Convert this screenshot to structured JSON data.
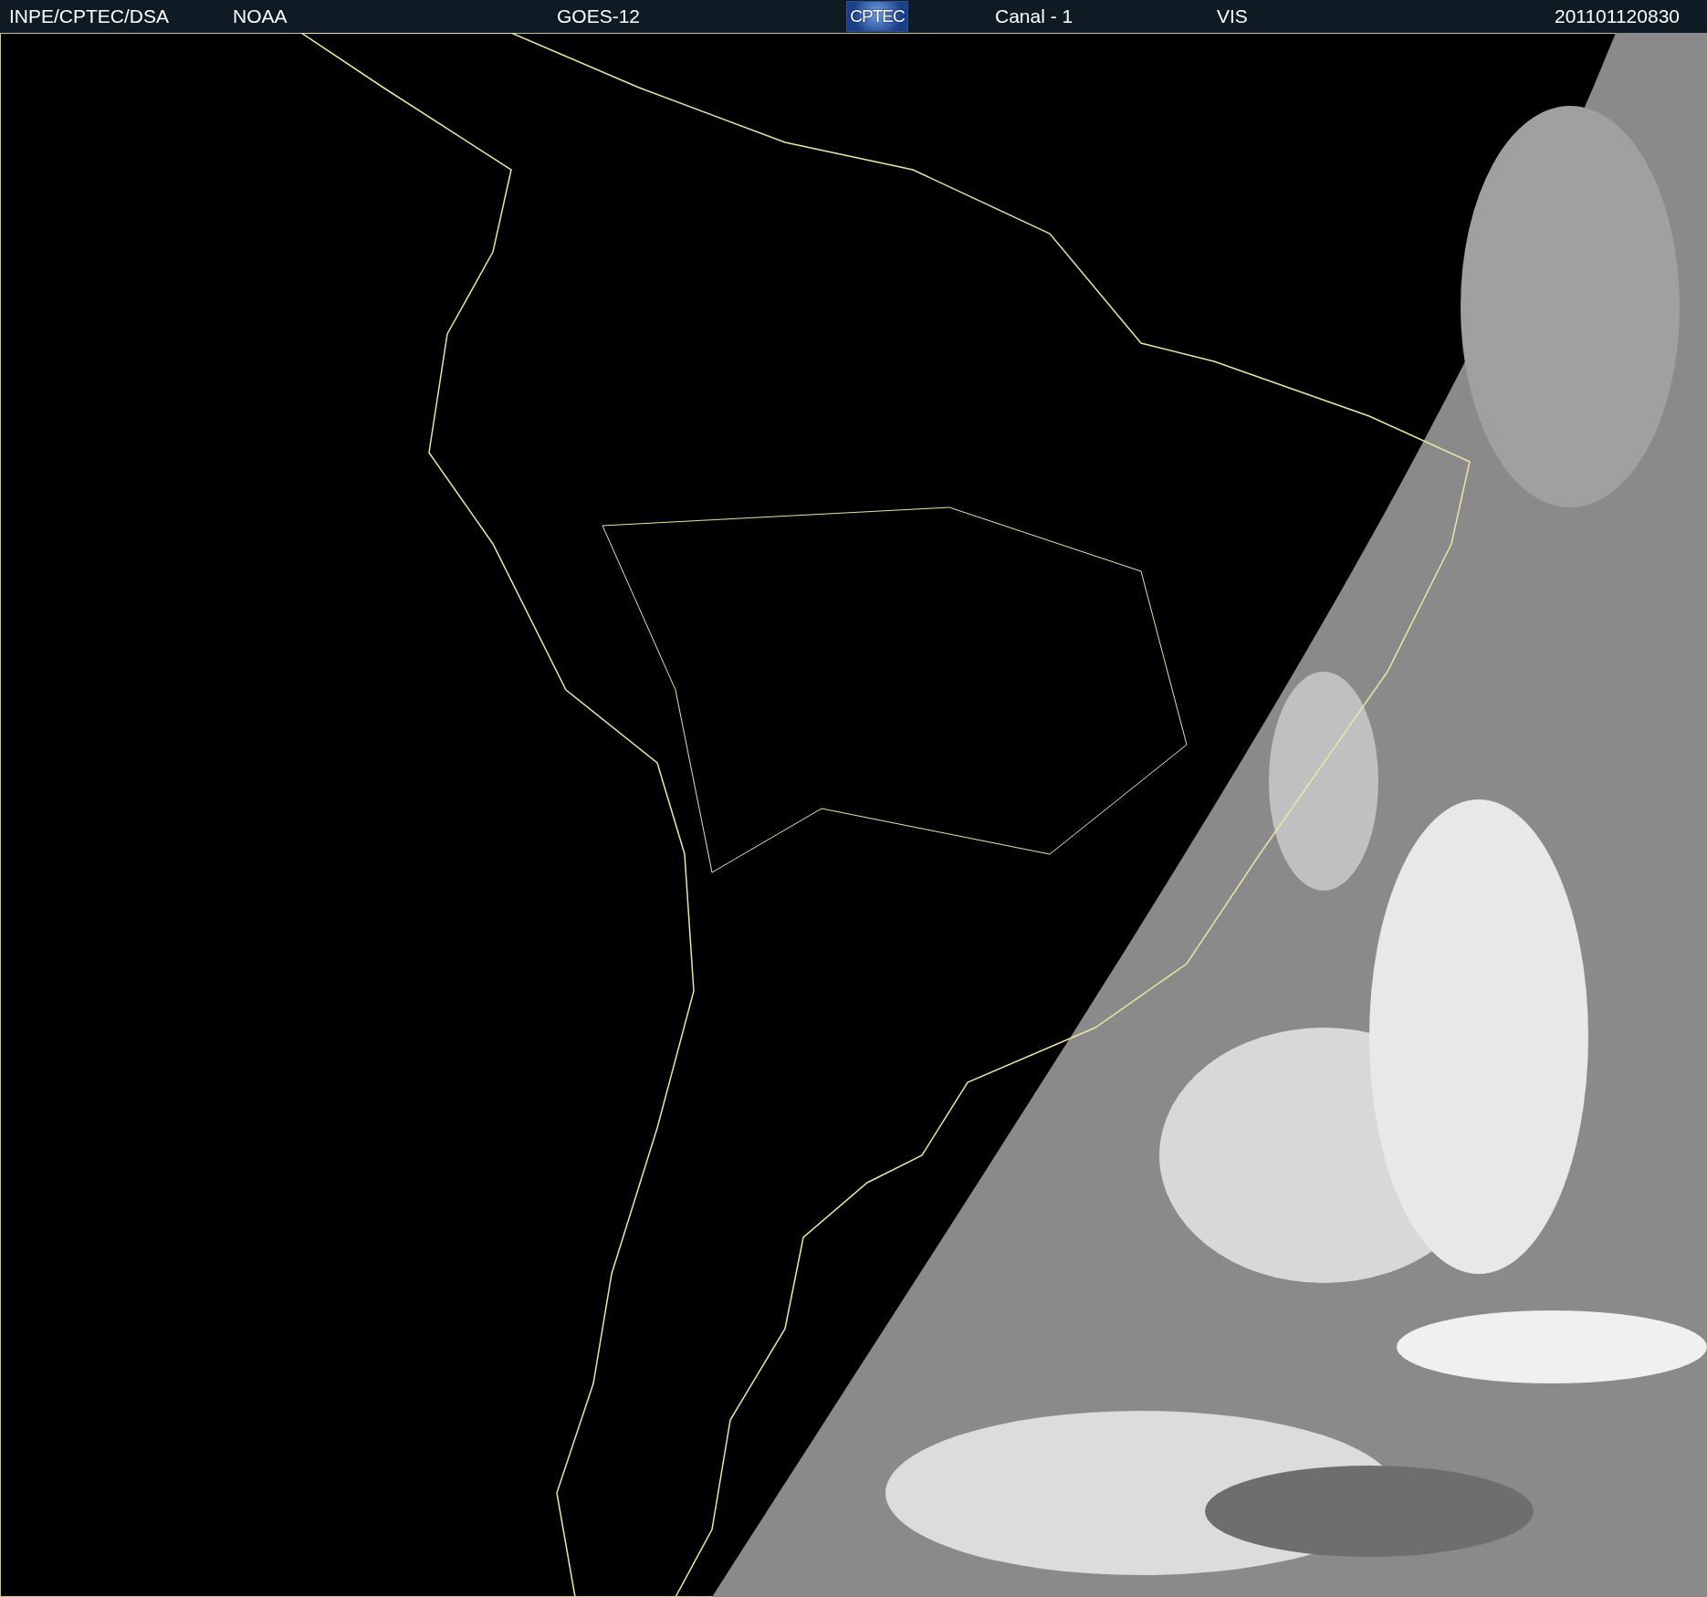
{
  "header": {
    "source": "INPE/CPTEC/DSA",
    "agency": "NOAA",
    "satellite": "GOES-12",
    "logo": "CPTEC",
    "channel": "Canal - 1",
    "band": "VIS",
    "timestamp": "201101120830"
  }
}
